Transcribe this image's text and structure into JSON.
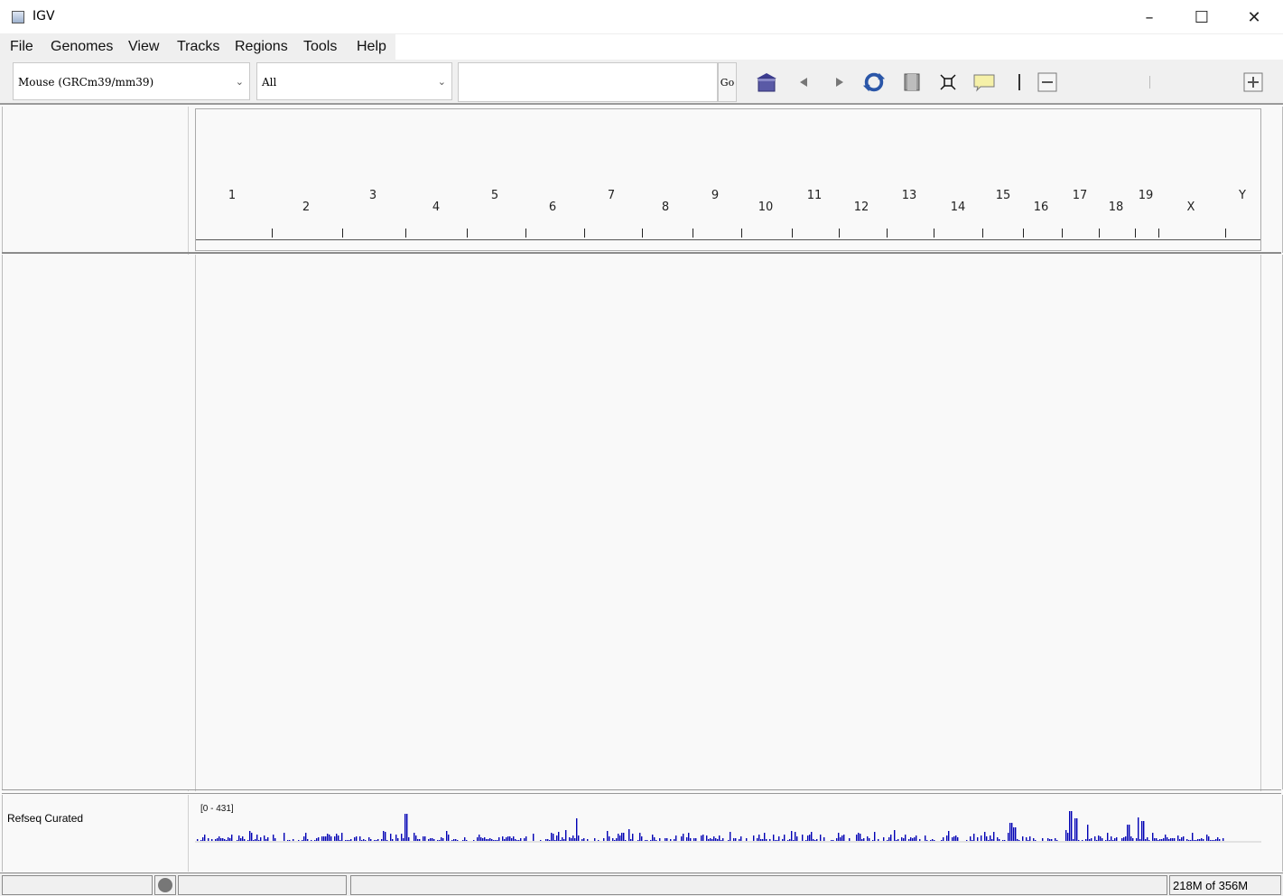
{
  "window": {
    "title": "IGV",
    "minimize": "–",
    "maximize": "☐",
    "close": "✕"
  },
  "menu": [
    "File",
    "Genomes",
    "View",
    "Tracks",
    "Regions",
    "Tools",
    "Help"
  ],
  "toolbar": {
    "genome": "Mouse (GRCm39/mm39)",
    "chromosome": "All",
    "locus_value": "",
    "go_label": "Go",
    "icons": [
      "home-icon",
      "back-icon",
      "forward-icon",
      "refresh-icon",
      "region-roi-icon",
      "fit-window-icon",
      "popup-info-icon",
      "ruler-divider-icon",
      "zoom-out-icon",
      "zoom-in-icon"
    ]
  },
  "ideogram": {
    "chromosomes": [
      {
        "name": "1",
        "row": "top"
      },
      {
        "name": "2",
        "row": "bottom"
      },
      {
        "name": "3",
        "row": "top"
      },
      {
        "name": "4",
        "row": "bottom"
      },
      {
        "name": "5",
        "row": "top"
      },
      {
        "name": "6",
        "row": "bottom"
      },
      {
        "name": "7",
        "row": "top"
      },
      {
        "name": "8",
        "row": "bottom"
      },
      {
        "name": "9",
        "row": "top"
      },
      {
        "name": "10",
        "row": "bottom"
      },
      {
        "name": "11",
        "row": "top"
      },
      {
        "name": "12",
        "row": "bottom"
      },
      {
        "name": "13",
        "row": "top"
      },
      {
        "name": "14",
        "row": "bottom"
      },
      {
        "name": "15",
        "row": "top"
      },
      {
        "name": "16",
        "row": "bottom"
      },
      {
        "name": "17",
        "row": "top"
      },
      {
        "name": "18",
        "row": "bottom"
      },
      {
        "name": "19",
        "row": "top"
      },
      {
        "name": "X",
        "row": "bottom"
      },
      {
        "name": "Y",
        "row": "top"
      }
    ]
  },
  "feature_track": {
    "name": "Refseq Curated",
    "range": "[0 - 431]",
    "color": "#0000b4"
  },
  "status": {
    "memory": "218M of 356M"
  }
}
